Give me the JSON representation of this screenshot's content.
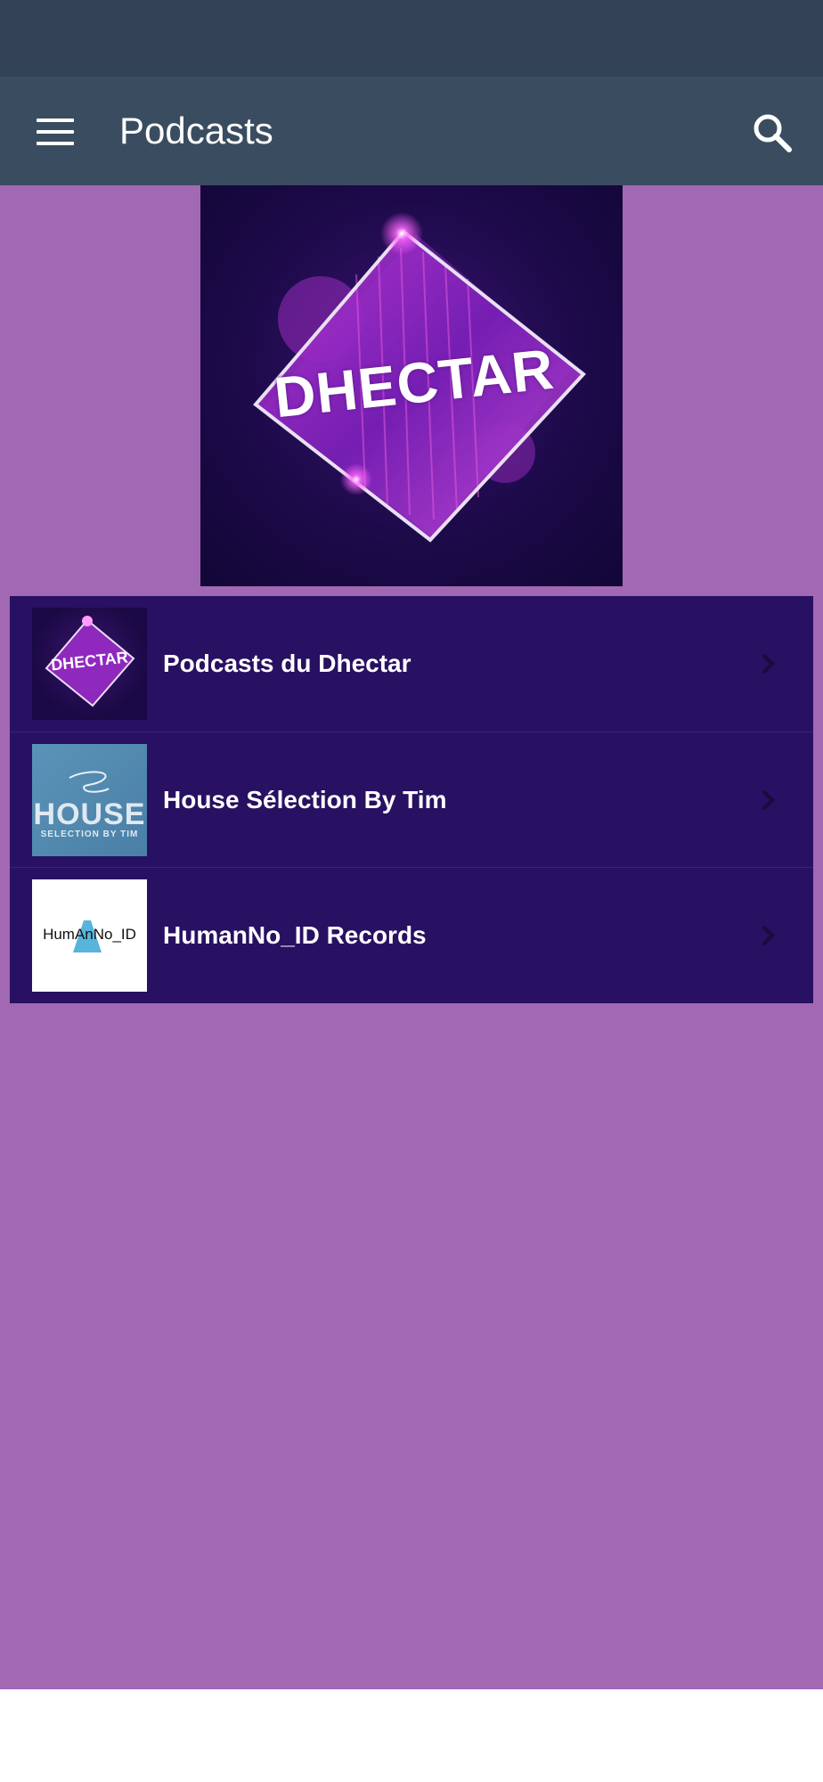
{
  "app_bar": {
    "title": "Podcasts",
    "menu_icon": "hamburger-menu-icon",
    "search_icon": "search-icon"
  },
  "hero": {
    "logo_text": "DHECTAR"
  },
  "podcasts": [
    {
      "title": "Podcasts du Dhectar",
      "thumb_text": "DHECTAR"
    },
    {
      "title": "House Sélection By Tim",
      "thumb_text": "HOUSE",
      "thumb_subtext": "SELECTION BY TIM"
    },
    {
      "title": "HumanNo_ID Records",
      "thumb_text": "HumAnNo_ID"
    }
  ],
  "colors": {
    "status_bar": "#334355",
    "app_bar": "#3a4c60",
    "background": "#a268b3",
    "list_background": "#281062"
  }
}
